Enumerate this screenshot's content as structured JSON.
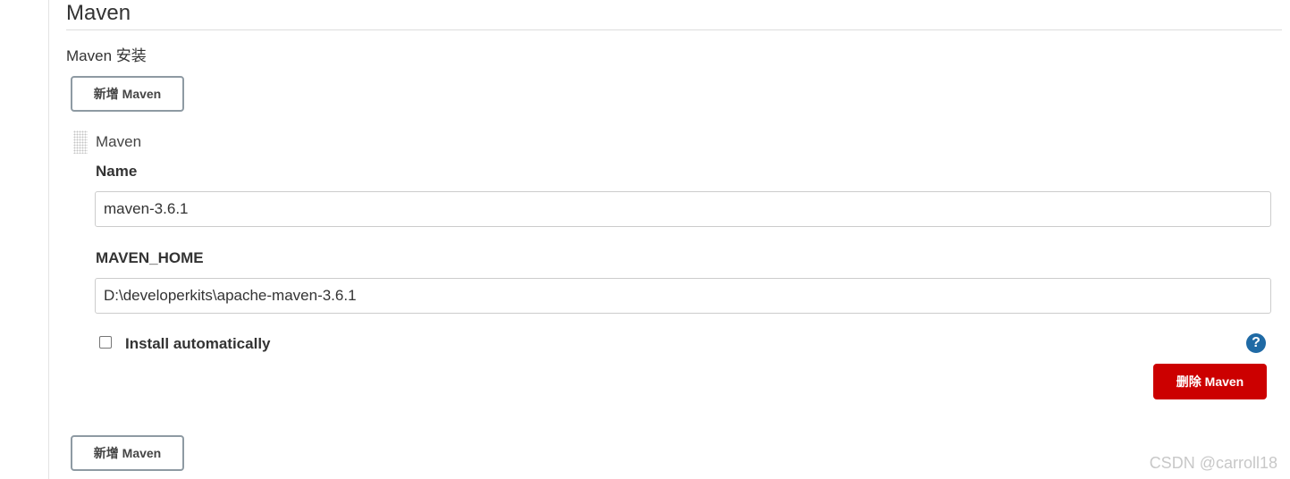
{
  "section": {
    "title": "Maven",
    "install_label": "Maven 安装"
  },
  "buttons": {
    "add_label": "新增 Maven",
    "delete_label": "删除 Maven"
  },
  "installation": {
    "heading": "Maven",
    "name_label": "Name",
    "name_value": "maven-3.6.1",
    "home_label": "MAVEN_HOME",
    "home_value": "D:\\developerkits\\apache-maven-3.6.1",
    "install_auto_label": "Install automatically",
    "install_auto_checked": false,
    "help_symbol": "?"
  },
  "watermark": "CSDN @carroll18",
  "colors": {
    "delete_button": "#cc0000",
    "help_icon": "#1f6aa5"
  },
  "icons": {
    "drag": "drag-handle-icon",
    "help": "help-icon"
  }
}
